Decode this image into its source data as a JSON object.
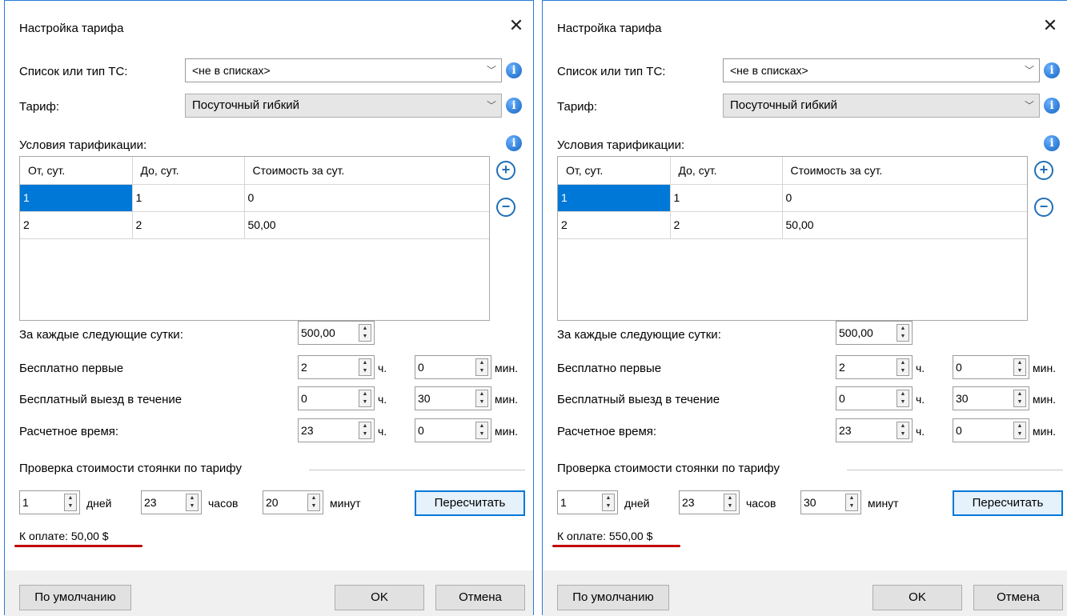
{
  "dialogs": [
    {
      "title": "Настройка тарифа",
      "vehicle_list_label": "Список или тип ТС:",
      "vehicle_list_value": "<не в списках>",
      "tariff_label": "Тариф:",
      "tariff_value": "Посуточный гибкий",
      "conditions_label": "Условия тарификации:",
      "table": {
        "columns": [
          "От, сут.",
          "До, сут.",
          "Стоимость за сут."
        ],
        "rows": [
          [
            "1",
            "1",
            "0"
          ],
          [
            "2",
            "2",
            "50,00"
          ]
        ]
      },
      "each_next_day_label": "За каждые следующие сутки:",
      "each_next_day_value": "500,00",
      "free_first_label": "Бесплатно первые",
      "free_first_hours": "2",
      "free_first_minutes": "0",
      "free_exit_label": "Бесплатный выезд в течение",
      "free_exit_hours": "0",
      "free_exit_minutes": "30",
      "calc_time_label": "Расчетное время:",
      "calc_time_hours": "23",
      "calc_time_minutes": "0",
      "hours_unit": "ч.",
      "minutes_unit": "мин.",
      "check_label": "Проверка стоимости стоянки по тарифу",
      "check_days": "1",
      "days_unit": "дней",
      "check_hours": "23",
      "hours_word": "часов",
      "check_minutes": "20",
      "minutes_word": "минут",
      "recalc_label": "Пересчитать",
      "payment_text": "К оплате: 50,00 $",
      "default_button": "По умолчанию",
      "ok_button": "OK",
      "cancel_button": "Отмена"
    },
    {
      "title": "Настройка тарифа",
      "vehicle_list_label": "Список или тип ТС:",
      "vehicle_list_value": "<не в списках>",
      "tariff_label": "Тариф:",
      "tariff_value": "Посуточный гибкий",
      "conditions_label": "Условия тарификации:",
      "table": {
        "columns": [
          "От, сут.",
          "До, сут.",
          "Стоимость за сут."
        ],
        "rows": [
          [
            "1",
            "1",
            "0"
          ],
          [
            "2",
            "2",
            "50,00"
          ]
        ]
      },
      "each_next_day_label": "За каждые следующие сутки:",
      "each_next_day_value": "500,00",
      "free_first_label": "Бесплатно первые",
      "free_first_hours": "2",
      "free_first_minutes": "0",
      "free_exit_label": "Бесплатный выезд в течение",
      "free_exit_hours": "0",
      "free_exit_minutes": "30",
      "calc_time_label": "Расчетное время:",
      "calc_time_hours": "23",
      "calc_time_minutes": "0",
      "hours_unit": "ч.",
      "minutes_unit": "мин.",
      "check_label": "Проверка стоимости стоянки по тарифу",
      "check_days": "1",
      "days_unit": "дней",
      "check_hours": "23",
      "hours_word": "часов",
      "check_minutes": "30",
      "minutes_word": "минут",
      "recalc_label": "Пересчитать",
      "payment_text": "К оплате: 550,00 $",
      "default_button": "По умолчанию",
      "ok_button": "OK",
      "cancel_button": "Отмена"
    }
  ],
  "colors": {
    "accent": "#0078d7",
    "underline_red": "#c00000",
    "info_blue": "#1565c0",
    "window_border": "#2b7bd6"
  },
  "icons": {
    "close": "close-icon",
    "info": "info-icon",
    "add": "add-row-icon",
    "remove": "remove-row-icon",
    "dropdown": "chevron-down-icon",
    "spinner": "spinner-icon"
  }
}
